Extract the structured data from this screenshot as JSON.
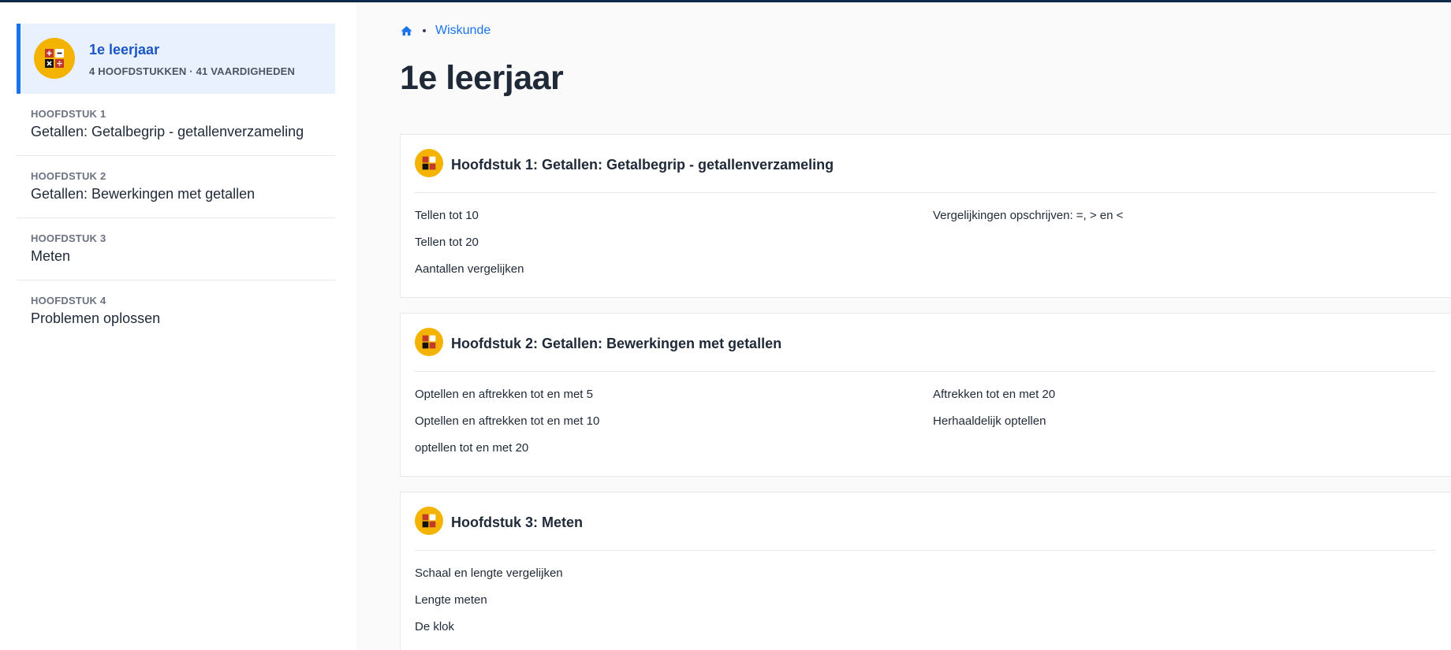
{
  "colors": {
    "accent": "#1a73e8",
    "logo_bg": "#f5b301",
    "top_bar": "#0f2a4a"
  },
  "sidebar": {
    "course": {
      "icon": "calculator-icon",
      "title": "1e leerjaar",
      "subtitle": "4 HOOFDSTUKKEN · 41 VAARDIGHEDEN"
    },
    "chapters": [
      {
        "kicker": "HOOFDSTUK 1",
        "name": "Getallen: Getalbegrip - getallenverzameling"
      },
      {
        "kicker": "HOOFDSTUK 2",
        "name": "Getallen: Bewerkingen met getallen"
      },
      {
        "kicker": "HOOFDSTUK 3",
        "name": "Meten"
      },
      {
        "kicker": "HOOFDSTUK 4",
        "name": "Problemen oplossen"
      }
    ]
  },
  "breadcrumb": {
    "home_icon": "home-icon",
    "link": "Wiskunde"
  },
  "page_title": "1e leerjaar",
  "cards": [
    {
      "title": "Hoofdstuk 1: Getallen: Getalbegrip - getallenverzameling",
      "left": [
        "Tellen tot 10",
        "Tellen tot 20",
        "Aantallen vergelijken"
      ],
      "right": [
        "Vergelijkingen opschrijven: =, > en <"
      ]
    },
    {
      "title": "Hoofdstuk 2: Getallen: Bewerkingen met getallen",
      "left": [
        "Optellen en aftrekken tot en met 5",
        "Optellen en aftrekken tot en met 10",
        "optellen tot en met 20"
      ],
      "right": [
        "Aftrekken tot en met 20",
        "Herhaaldelijk optellen"
      ]
    },
    {
      "title": "Hoofdstuk 3: Meten",
      "left": [
        "Schaal en lengte vergelijken",
        "Lengte meten",
        "De klok"
      ],
      "right": []
    }
  ]
}
